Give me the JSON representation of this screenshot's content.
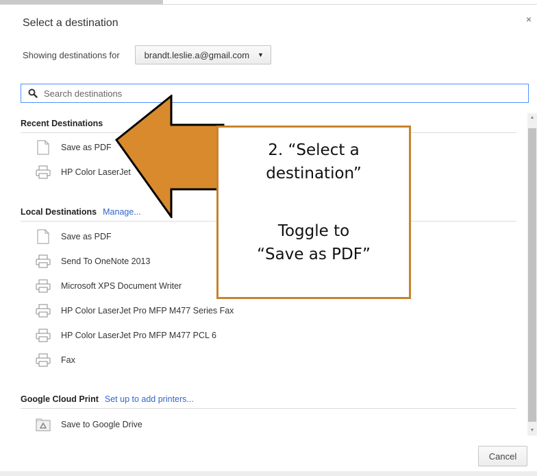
{
  "dialog": {
    "title": "Select a destination",
    "close_glyph": "×",
    "showing_label": "Showing destinations for",
    "account": "brandt.leslie.a@gmail.com",
    "search": {
      "placeholder": "Search destinations",
      "value": ""
    },
    "cancel_label": "Cancel"
  },
  "sections": {
    "recent": {
      "title": "Recent Destinations",
      "items": [
        {
          "label": "Save as PDF",
          "icon": "document-icon"
        },
        {
          "label": "HP Color LaserJet",
          "icon": "printer-icon"
        }
      ]
    },
    "local": {
      "title": "Local Destinations",
      "link": "Manage...",
      "items": [
        {
          "label": "Save as PDF",
          "icon": "document-icon"
        },
        {
          "label": "Send To OneNote 2013",
          "icon": "printer-icon"
        },
        {
          "label": "Microsoft XPS Document Writer",
          "icon": "printer-icon"
        },
        {
          "label": "HP Color LaserJet Pro MFP M477 Series Fax",
          "icon": "printer-icon"
        },
        {
          "label": "HP Color LaserJet Pro MFP M477 PCL 6",
          "icon": "printer-icon"
        },
        {
          "label": "Fax",
          "icon": "printer-icon"
        }
      ]
    },
    "cloud": {
      "title": "Google Cloud Print",
      "link": "Set up to add printers...",
      "items": [
        {
          "label": "Save to Google Drive",
          "icon": "google-drive-icon"
        }
      ]
    }
  },
  "annotation": {
    "line1": "2. “Select a",
    "line2": "destination”",
    "line3": "Toggle to",
    "line4": "“Save as PDF”",
    "arrow_color": "#d88a2c",
    "border_color": "#c7832c"
  },
  "colors": {
    "accent_link": "#3366cc",
    "search_focus": "#4d90fe"
  }
}
